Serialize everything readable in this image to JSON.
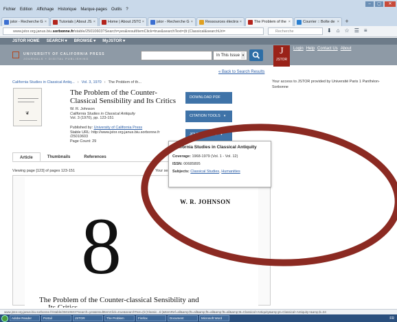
{
  "browser": {
    "menu": [
      "Fichier",
      "Edition",
      "Affichage",
      "Historique",
      "Marque-pages",
      "Outils",
      "?"
    ],
    "tabs": [
      {
        "label": "jstor - Recherche G...",
        "color": "#3b6fd1",
        "active": false
      },
      {
        "label": "Tutorials | About JS...",
        "color": "#b3241c",
        "active": false
      },
      {
        "label": "Home | About JSTOR",
        "color": "#b3241c",
        "active": false
      },
      {
        "label": "jstor - Recherche G...",
        "color": "#3b6fd1",
        "active": false
      },
      {
        "label": "Ressources électron...",
        "color": "#e0a020",
        "active": false
      },
      {
        "label": "The Problem of the ...",
        "color": "#b3241c",
        "active": true
      },
      {
        "label": "Courrier :: Boîte de r...",
        "color": "#2a7fd0",
        "active": false
      }
    ],
    "url_prefix": "www.jstor.org.janus.biu.",
    "url_domain": "sorbonne.fr",
    "url_rest": "/stable/25010603?Search=yes&resultItemClick=true&searchText=(ti:(Classical&searchUri=",
    "search_placeholder": "Recherche",
    "status_url": "www.jstor.org.janus.biu.sorbonne.fr/stable/25010603?Search=yes&resultItemClick=true&searchText=(ti:(Classic...ti:(&ItemRef=all&amp;f5=all&amp;f5=all&amp;f5=all&amp;t5=Classical+Antiquity&amp;pt=Classical+Antiquity+&amp;b=34"
  },
  "jstor": {
    "nav": [
      "JSTOR HOME",
      "SEARCH ▾",
      "BROWSE ▾",
      "MyJSTOR ▾"
    ],
    "publisher_name": "UNIVERSITY OF CALIFORNIA PRESS",
    "publisher_sub": "JOURNALS + DIGITAL PUBLISHING",
    "scope": "In This Issue",
    "logo_text": "JSTOR",
    "top_links": [
      "Login",
      "Help",
      "Contact Us",
      "About"
    ]
  },
  "content": {
    "back_link": "« Back to Search Results",
    "breadcrumb": [
      "California Studies in Classical Antiq...",
      "Vol. 3, 1970",
      "The Problem of th..."
    ],
    "access_note": "Your access to JSTOR provided by Université Paris 1 Panthéon-Sorbonne",
    "title": "The Problem of the Counter-Classical Sensibility and Its Critics",
    "author": "W. R. Johnson",
    "journal": "California Studies in Classical Antiquity",
    "volume": "Vol. 3 (1970), pp. 123-151",
    "published_by_label": "Published by:",
    "publisher_link": "University of California Press",
    "stable_url": "Stable URL: http://www.jstor.org.janus.biu.sorbonne.fr",
    "stable_id": "/25010603",
    "page_count": "Page Count: 29",
    "buttons": {
      "download": "DOWNLOAD PDF",
      "citation": "CITATION TOOLS",
      "journal_info": "JOURNAL INFO"
    },
    "tabs": [
      "Article",
      "Thumbnails",
      "References"
    ],
    "page_info": "Viewing page [123] of pages 123-151",
    "search_terms": "Your search term"
  },
  "scan": {
    "author": "W. R. JOHNSON",
    "numeral": "8",
    "title_line1": "The Problem of the Counter-classical Sensibility and",
    "title_line2": "Its Critics"
  },
  "journal_popup": {
    "title": "California Studies in Classical Antiquity",
    "coverage_label": "Coverage:",
    "coverage": "1968-1979 (Vol. 1 - Vol. 12)",
    "issn_label": "ISSN:",
    "issn": "00685895",
    "subjects_label": "Subjects:",
    "subject1": "Classical Studies",
    "subject2": "Humanities"
  },
  "taskbar": {
    "tasks": [
      "Adobe Reader",
      "Portail",
      "JSTOR",
      "The Problem",
      "Firefox",
      "Document",
      "Microsoft Word"
    ],
    "tray": "FR"
  },
  "colors": {
    "accent": "#3f73a8",
    "annotation": "#8b2a22",
    "jstor_red": "#9a2218"
  }
}
